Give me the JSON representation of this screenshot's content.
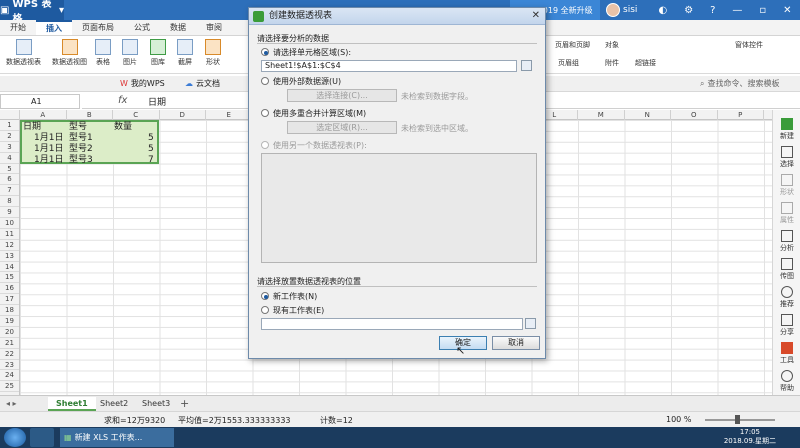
{
  "titlebar": {
    "app_label": "WPS 表格",
    "upgrade_label": "WPS 2019 全新升级",
    "user_name": "sisi"
  },
  "ribbon_tabs": [
    "开始",
    "插入",
    "页面布局",
    "公式",
    "数据",
    "审阅"
  ],
  "ribbon_buttons": [
    "数据透视表",
    "数据透视图",
    "表格",
    "图片",
    "图库",
    "截屏",
    "形状"
  ],
  "ribbon_right_labels": [
    "页眉和页脚",
    "对象",
    "页眉组",
    "附件",
    "超链接",
    "窗体控件"
  ],
  "doc_tabs": {
    "my_wps": "我的WPS",
    "cloud": "云文档"
  },
  "search_hint": "查找命令、搜索模板",
  "formula_bar": {
    "name_box": "A1",
    "fx": "fx",
    "content": "日期"
  },
  "columns": [
    "A",
    "B",
    "C",
    "D",
    "E",
    "F",
    "G",
    "H",
    "I",
    "J",
    "K",
    "L",
    "M",
    "N",
    "O",
    "P"
  ],
  "rows": [
    "1",
    "2",
    "3",
    "4",
    "5",
    "6",
    "7",
    "8",
    "9",
    "10",
    "11",
    "12",
    "13",
    "14",
    "15",
    "16",
    "17",
    "18",
    "19",
    "20",
    "21",
    "22",
    "23",
    "24",
    "25"
  ],
  "table": {
    "headers": [
      "日期",
      "型号",
      "数量"
    ],
    "rows": [
      [
        "1月1日",
        "型号1",
        "5"
      ],
      [
        "1月1日",
        "型号2",
        "5"
      ],
      [
        "1月1日",
        "型号3",
        "7"
      ]
    ]
  },
  "sidebar": [
    "新建",
    "选择",
    "形状",
    "属性",
    "分析",
    "传图",
    "推荐",
    "分享",
    "工具",
    "帮助"
  ],
  "sheets": [
    "Sheet1",
    "Sheet2",
    "Sheet3"
  ],
  "status": {
    "sum": "求和=12万9320",
    "avg": "平均值=2万1553.333333333",
    "count": "计数=12",
    "zoom": "100 %"
  },
  "taskbar": {
    "active_task": "新建 XLS 工作表...",
    "time": "17:05",
    "date": "2018.09.星期二"
  },
  "dialog": {
    "title": "创建数据透视表",
    "section1": "请选择要分析的数据",
    "opt_range": "请选择单元格区域(S):",
    "range_value": "Sheet1!$A$1:$C$4",
    "opt_external": "使用外部数据源(U)",
    "btn_select_conn": "选择连接(C)...",
    "no_conn_text": "未检索到数据字段。",
    "opt_multi": "使用多重合并计算区域(M)",
    "btn_select_region": "选定区域(R)...",
    "no_region_text": "未检索到选中区域。",
    "opt_other": "使用另一个数据透视表(P):",
    "section2": "请选择放置数据透视表的位置",
    "opt_new_sheet": "新工作表(N)",
    "opt_existing": "现有工作表(E)",
    "ok": "确定",
    "cancel": "取消"
  }
}
